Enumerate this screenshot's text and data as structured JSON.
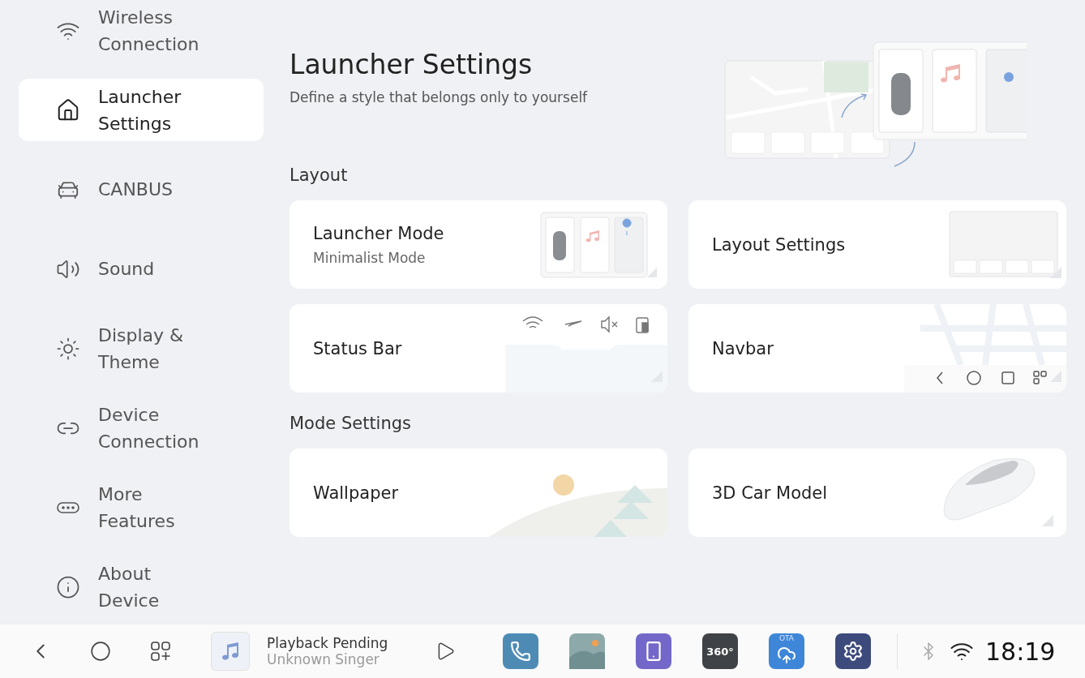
{
  "sidebar": {
    "items": [
      {
        "label": "Wireless Connection",
        "selected": false
      },
      {
        "label": "Launcher Settings",
        "selected": true
      },
      {
        "label": "CANBUS",
        "selected": false
      },
      {
        "label": "Sound",
        "selected": false
      },
      {
        "label": "Display & Theme",
        "selected": false
      },
      {
        "label": "Device Connection",
        "selected": false
      },
      {
        "label": "More Features",
        "selected": false
      },
      {
        "label": "About Device",
        "selected": false
      }
    ]
  },
  "header": {
    "title": "Launcher Settings",
    "subtitle": "Define a style that belongs only to yourself"
  },
  "sections": [
    {
      "title": "Layout",
      "cards": [
        {
          "title": "Launcher Mode",
          "subtitle": "Minimalist Mode",
          "kind": "launcher"
        },
        {
          "title": "Layout Settings",
          "kind": "layout"
        },
        {
          "title": "Status Bar",
          "kind": "statusbar"
        },
        {
          "title": "Navbar",
          "kind": "navbar"
        }
      ]
    },
    {
      "title": "Mode Settings",
      "cards": [
        {
          "title": "Wallpaper",
          "kind": "wallpaper"
        },
        {
          "title": "3D Car Model",
          "kind": "car"
        }
      ]
    }
  ],
  "media": {
    "title": "Playback Pending",
    "artist": "Unknown Singer"
  },
  "dock": [
    {
      "kind": "phone"
    },
    {
      "kind": "gallery"
    },
    {
      "kind": "mirror"
    },
    {
      "kind": "camera360",
      "label": "360°"
    },
    {
      "kind": "ota",
      "label": "OTA"
    },
    {
      "kind": "settings"
    }
  ],
  "status_bar": {
    "time": "18:19"
  }
}
